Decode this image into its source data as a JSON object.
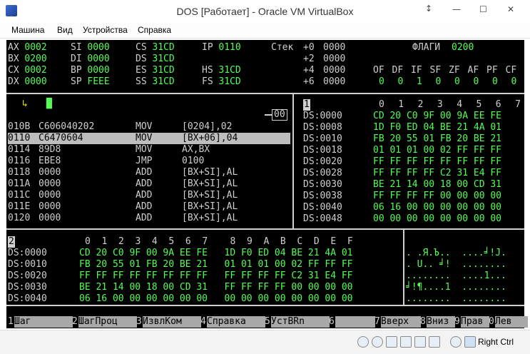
{
  "window": {
    "title": "DOS [Работает] - Oracle VM VirtualBox",
    "minimize": "—",
    "maximize": "☐",
    "close": "✕",
    "restore_arrows": "↕"
  },
  "menu": [
    "Машина",
    "Вид",
    "Устройства",
    "Справка"
  ],
  "registers": {
    "rows": [
      [
        {
          "n": "AX",
          "v": "0002"
        },
        {
          "n": "SI",
          "v": "0000"
        },
        {
          "n": "CS",
          "v": "31CD"
        },
        {
          "n": "IP",
          "v": "0110"
        }
      ],
      [
        {
          "n": "BX",
          "v": "0200"
        },
        {
          "n": "DI",
          "v": "0000"
        },
        {
          "n": "DS",
          "v": "31CD"
        }
      ],
      [
        {
          "n": "CX",
          "v": "0002"
        },
        {
          "n": "BP",
          "v": "0000"
        },
        {
          "n": "ES",
          "v": "31CD"
        },
        {
          "n": "HS",
          "v": "31CD"
        }
      ],
      [
        {
          "n": "DX",
          "v": "0000"
        },
        {
          "n": "SP",
          "v": "FEEE"
        },
        {
          "n": "SS",
          "v": "31CD"
        },
        {
          "n": "FS",
          "v": "31CD"
        }
      ]
    ]
  },
  "stack": {
    "label": "Стек",
    "rows": [
      {
        "off": "+0",
        "v": "0000"
      },
      {
        "off": "+2",
        "v": "0000"
      },
      {
        "off": "+4",
        "v": "0000"
      },
      {
        "off": "+6",
        "v": "0000"
      }
    ]
  },
  "flags": {
    "label": "ФЛАГИ",
    "value": "0200",
    "names": [
      "OF",
      "DF",
      "IF",
      "SF",
      "ZF",
      "AF",
      "PF",
      "CF"
    ],
    "values": [
      "0",
      "0",
      "1",
      "0",
      "0",
      "0",
      "0",
      "0"
    ]
  },
  "cmd": {
    "prompt": "↳",
    "cursor": "█"
  },
  "disasm": {
    "marker": "00",
    "rows": [
      {
        "addr": "010B",
        "bytes": "C606040202",
        "op": "MOV",
        "args": "[0204],02",
        "selected": false
      },
      {
        "addr": "0110",
        "bytes": "C6470604",
        "op": "MOV",
        "args": "[BX+06],04",
        "selected": true
      },
      {
        "addr": "0114",
        "bytes": "89D8",
        "op": "MOV",
        "args": "AX,BX",
        "selected": false
      },
      {
        "addr": "0116",
        "bytes": "EBE8",
        "op": "JMP",
        "args": "0100",
        "selected": false
      },
      {
        "addr": "0118",
        "bytes": "0000",
        "op": "ADD",
        "args": "[BX+SI],AL",
        "selected": false
      },
      {
        "addr": "011A",
        "bytes": "0000",
        "op": "ADD",
        "args": "[BX+SI],AL",
        "selected": false
      },
      {
        "addr": "011C",
        "bytes": "0000",
        "op": "ADD",
        "args": "[BX+SI],AL",
        "selected": false
      },
      {
        "addr": "011E",
        "bytes": "0000",
        "op": "ADD",
        "args": "[BX+SI],AL",
        "selected": false
      },
      {
        "addr": "0120",
        "bytes": "0000",
        "op": "ADD",
        "args": "[BX+SI],AL",
        "selected": false
      }
    ]
  },
  "dump1": {
    "title": "1",
    "cols": [
      "0",
      "1",
      "2",
      "3",
      "4",
      "5",
      "6",
      "7"
    ],
    "rows": [
      {
        "addr": "DS:0000",
        "bytes": "CD 20 C0 9F 00 9A EE FE"
      },
      {
        "addr": "DS:0008",
        "bytes": "1D F0 ED 04 BE 21 4A 01"
      },
      {
        "addr": "DS:0010",
        "bytes": "FB 20 55 01 FB 20 BE 21"
      },
      {
        "addr": "DS:0018",
        "bytes": "01 01 01 00 02 FF FF FF"
      },
      {
        "addr": "DS:0020",
        "bytes": "FF FF FF FF FF FF FF FF"
      },
      {
        "addr": "DS:0028",
        "bytes": "FF FF FF FF C2 31 E4 FF"
      },
      {
        "addr": "DS:0030",
        "bytes": "BE 21 14 00 18 00 CD 31"
      },
      {
        "addr": "DS:0038",
        "bytes": "FF FF FF FF 00 00 00 00"
      },
      {
        "addr": "DS:0040",
        "bytes": "06 16 00 00 00 00 00 00"
      },
      {
        "addr": "DS:0048",
        "bytes": "00 00 00 00 00 00 00 00"
      }
    ]
  },
  "dump2": {
    "title": "2",
    "cols": "0  1  2  3  4  5  6  7    8  9  A  B  C  D  E  F",
    "rows": [
      {
        "addr": "DS:0000",
        "bytes": "CD 20 C0 9F 00 9A EE FE   1D F0 ED 04 BE 21 4A 01",
        "ascii": ". .Я.Ъ..  ....╛!J."
      },
      {
        "addr": "DS:0010",
        "bytes": "FB 20 55 01 FB 20 BE 21   01 01 01 00 02 FF FF FF",
        "ascii": ". U.. ╛!  ........"
      },
      {
        "addr": "DS:0020",
        "bytes": "FF FF FF FF FF FF FF FF   FF FF FF FF C2 31 E4 FF",
        "ascii": "........  ....1..."
      },
      {
        "addr": "DS:0030",
        "bytes": "BE 21 14 00 18 00 CD 31   FF FF FF FF 00 00 00 00",
        "ascii": "╛!¶....1  ........"
      },
      {
        "addr": "DS:0040",
        "bytes": "06 16 00 00 00 00 00 00   00 00 00 00 00 00 00 00",
        "ascii": "........  ........"
      }
    ]
  },
  "fkeys": [
    {
      "n": "1",
      "label": "Шаг"
    },
    {
      "n": "2",
      "label": "ШагПроц"
    },
    {
      "n": "3",
      "label": "ИзвлКом"
    },
    {
      "n": "4",
      "label": "Справка"
    },
    {
      "n": "5",
      "label": "УстBRn"
    },
    {
      "n": "6",
      "label": ""
    },
    {
      "n": "7",
      "label": "Вверх"
    },
    {
      "n": "8",
      "label": "Вниз"
    },
    {
      "n": "9",
      "label": "Прав"
    },
    {
      "n": "0",
      "label": "Лев"
    }
  ],
  "status": {
    "host_key": "Right Ctrl"
  },
  "colors": {
    "screen_bg": "#000000",
    "value_green": "#54fc54",
    "text_gray": "#cfcfcf",
    "selection": "#bdbdbd"
  }
}
